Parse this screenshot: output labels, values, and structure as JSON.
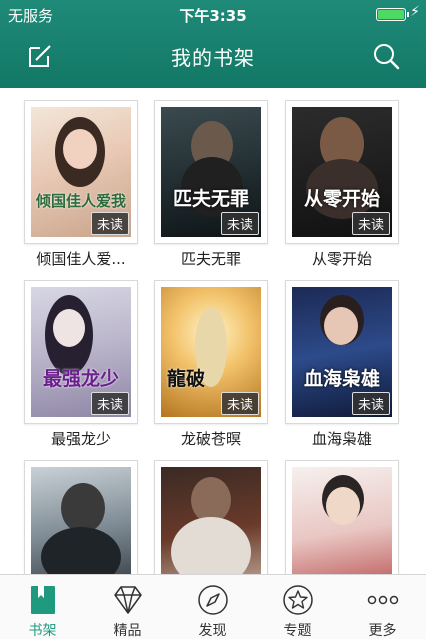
{
  "status": {
    "carrier": "无服务",
    "time": "下午3:35",
    "battery_level": 1.0
  },
  "header": {
    "title": "我的书架"
  },
  "colors": {
    "header": "#1a8270",
    "accent": "#1f9a7e",
    "battery": "#4cd964"
  },
  "books": [
    {
      "title": "倾国佳人爱...",
      "badge": "未读",
      "cover_text": "倾国佳人爱我"
    },
    {
      "title": "匹夫无罪",
      "badge": "未读",
      "cover_text": "匹夫无罪"
    },
    {
      "title": "从零开始",
      "badge": "未读",
      "cover_text": "从零开始"
    },
    {
      "title": "最强龙少",
      "badge": "未读",
      "cover_text": "最强龙少"
    },
    {
      "title": "龙破苍暝",
      "badge": "未读",
      "cover_text": "龍破"
    },
    {
      "title": "血海枭雄",
      "badge": "未读",
      "cover_text": "血海枭雄"
    },
    {
      "title": "",
      "badge": "",
      "cover_text": ""
    },
    {
      "title": "",
      "badge": "",
      "cover_text": ""
    },
    {
      "title": "",
      "badge": "",
      "cover_text": ""
    }
  ],
  "tabs": [
    {
      "label": "书架",
      "icon": "bookmark-icon"
    },
    {
      "label": "精品",
      "icon": "diamond-icon"
    },
    {
      "label": "发现",
      "icon": "compass-icon"
    },
    {
      "label": "专题",
      "icon": "star-icon"
    },
    {
      "label": "更多",
      "icon": "more-icon"
    }
  ]
}
